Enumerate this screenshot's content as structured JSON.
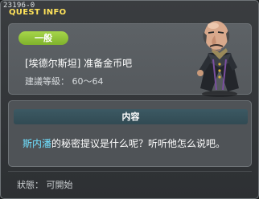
{
  "window": {
    "quest_id": "23196-0",
    "title": "QUEST INFO"
  },
  "quest": {
    "category_badge": "一般",
    "name": "[埃德尔斯坦] 准备金币吧",
    "level_label": "建議等級",
    "level_separator": "：",
    "level_range": "60～64"
  },
  "content": {
    "header": "内容",
    "npc_name": "斯内潘",
    "text_rest": "的秘密提议是什么呢？听听他怎么说吧。"
  },
  "status": {
    "label": "狀態",
    "separator": "：",
    "value": "可開始"
  },
  "colors": {
    "title": "#ffe35a",
    "badge": "#8fc236",
    "npc_highlight": "#6fe0ff",
    "content_header": "#365058"
  },
  "icons": {
    "npc_portrait": "npc-portrait-icon"
  }
}
